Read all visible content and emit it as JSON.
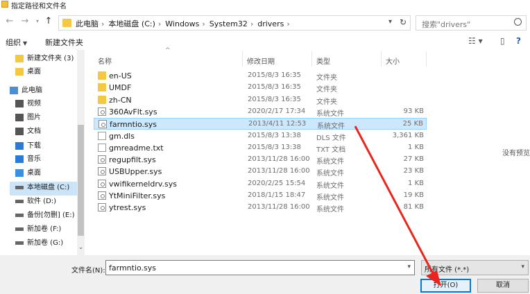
{
  "window": {
    "title": "指定路径和文件名"
  },
  "address": {
    "crumbs": [
      "此电脑",
      "本地磁盘 (C:)",
      "Windows",
      "System32",
      "drivers"
    ],
    "separator": "›",
    "search_placeholder": "搜索\"drivers\""
  },
  "toolbar": {
    "organize": "组织",
    "new_folder": "新建文件夹"
  },
  "sidebar": {
    "items": [
      {
        "label": "新建文件夹 (3)",
        "icon": "folder-icon"
      },
      {
        "label": "桌面",
        "icon": "folder-icon"
      },
      {
        "label": "此电脑",
        "icon": "computer-icon"
      },
      {
        "label": "视频",
        "icon": "video-icon"
      },
      {
        "label": "图片",
        "icon": "picture-icon"
      },
      {
        "label": "文档",
        "icon": "document-icon"
      },
      {
        "label": "下载",
        "icon": "download-icon"
      },
      {
        "label": "音乐",
        "icon": "music-icon"
      },
      {
        "label": "桌面",
        "icon": "desktop-icon"
      },
      {
        "label": "本地磁盘 (C:)",
        "icon": "drive-icon"
      },
      {
        "label": "软件 (D:)",
        "icon": "drive-icon"
      },
      {
        "label": "备份[勿删] (E:)",
        "icon": "drive-icon"
      },
      {
        "label": "新加卷 (F:)",
        "icon": "drive-icon"
      },
      {
        "label": "新加卷 (G:)",
        "icon": "drive-icon"
      }
    ]
  },
  "columns": {
    "name": "名称",
    "date": "修改日期",
    "type": "类型",
    "size": "大小"
  },
  "files": [
    {
      "name": "en-US",
      "date": "2015/8/3 16:35",
      "type": "文件夹",
      "size": "",
      "icon": "folder"
    },
    {
      "name": "UMDF",
      "date": "2015/8/3 16:35",
      "type": "文件夹",
      "size": "",
      "icon": "folder"
    },
    {
      "name": "zh-CN",
      "date": "2015/8/3 16:35",
      "type": "文件夹",
      "size": "",
      "icon": "folder"
    },
    {
      "name": "360AvFlt.sys",
      "date": "2020/2/17 17:34",
      "type": "系统文件",
      "size": "93 KB",
      "icon": "sys"
    },
    {
      "name": "farmntio.sys",
      "date": "2013/4/11 12:53",
      "type": "系统文件",
      "size": "25 KB",
      "icon": "sys",
      "selected": true
    },
    {
      "name": "gm.dls",
      "date": "2015/8/3 13:38",
      "type": "DLS 文件",
      "size": "3,361 KB",
      "icon": "file"
    },
    {
      "name": "gmreadme.txt",
      "date": "2015/8/3 13:38",
      "type": "TXT 文档",
      "size": "1 KB",
      "icon": "file"
    },
    {
      "name": "regupfilt.sys",
      "date": "2013/11/28 16:00",
      "type": "系统文件",
      "size": "27 KB",
      "icon": "sys"
    },
    {
      "name": "USBUpper.sys",
      "date": "2013/11/28 16:00",
      "type": "系统文件",
      "size": "23 KB",
      "icon": "sys"
    },
    {
      "name": "vwifikerneldrv.sys",
      "date": "2020/2/25 15:54",
      "type": "系统文件",
      "size": "1 KB",
      "icon": "sys"
    },
    {
      "name": "YtMiniFilter.sys",
      "date": "2018/1/15 18:47",
      "type": "系统文件",
      "size": "19 KB",
      "icon": "sys"
    },
    {
      "name": "ytrest.sys",
      "date": "2013/11/28 16:00",
      "type": "系统文件",
      "size": "81 KB",
      "icon": "sys"
    }
  ],
  "preview_text": "没有预览",
  "bottom": {
    "filename_label": "文件名(N):",
    "filename_value": "farmntio.sys",
    "filter_value": "所有文件 (*.*)",
    "open_button": "打开(O)",
    "cancel_button": "取消"
  },
  "colors": {
    "selection": "#cce8ff",
    "accent": "#0078d7",
    "arrow": "#e8261e"
  }
}
